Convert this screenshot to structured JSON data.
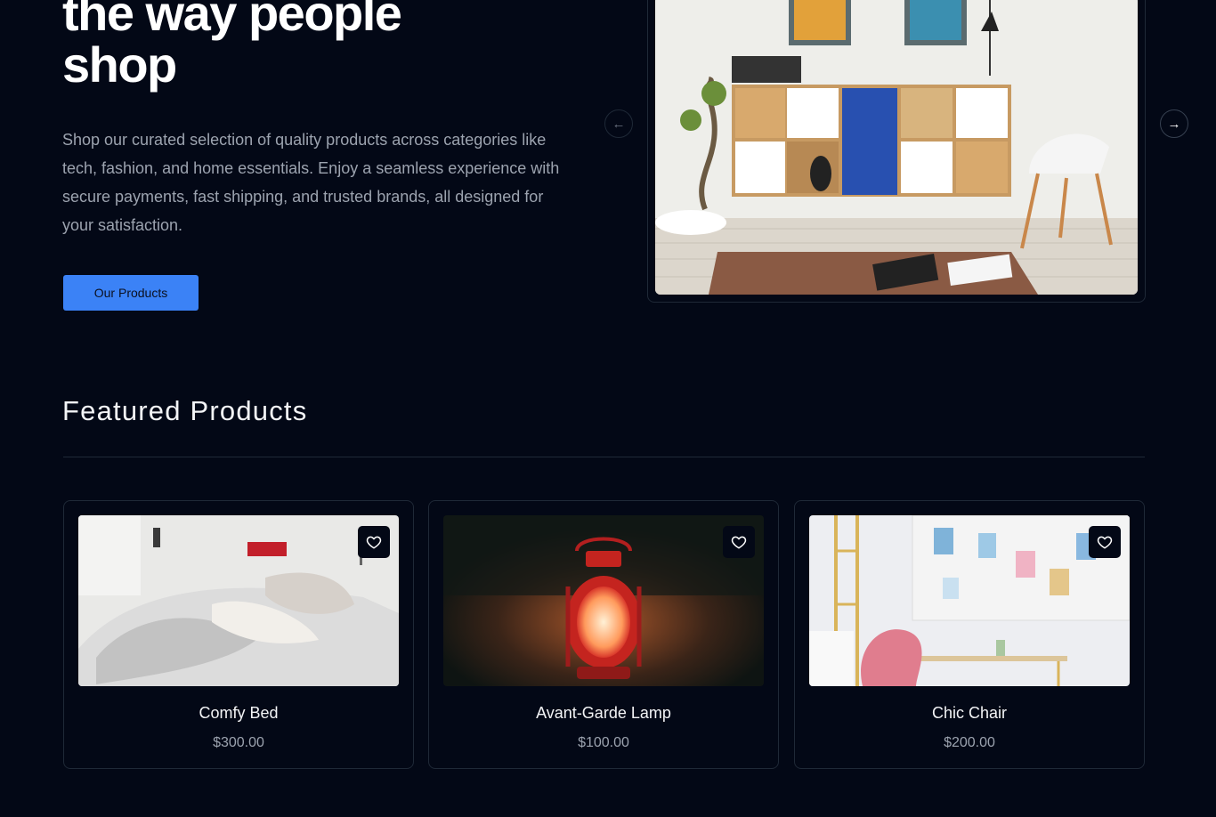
{
  "hero": {
    "title_line1": "the way people",
    "title_line2": "shop",
    "description": "Shop our curated selection of quality products across categories like tech, fashion, and home essentials. Enjoy a seamless experience with secure payments, fast shipping, and trusted brands, all designed for your satisfaction.",
    "cta_label": "Our Products",
    "carousel_prev_icon": "arrow-left-icon",
    "carousel_next_icon": "arrow-right-icon"
  },
  "featured": {
    "title": "Featured Products",
    "products": [
      {
        "name": "Comfy Bed",
        "price": "$300.00",
        "wishlist_icon": "heart-icon"
      },
      {
        "name": "Avant-Garde Lamp",
        "price": "$100.00",
        "wishlist_icon": "heart-icon"
      },
      {
        "name": "Chic Chair",
        "price": "$200.00",
        "wishlist_icon": "heart-icon"
      }
    ]
  },
  "colors": {
    "background": "#030816",
    "accent": "#3b82f6",
    "border": "#1f2937",
    "muted_text": "#9ca3af"
  }
}
